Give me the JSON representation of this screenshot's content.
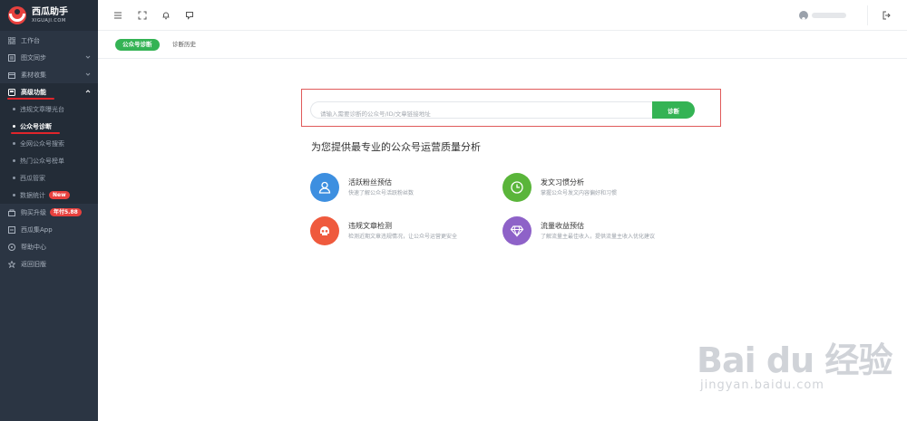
{
  "app": {
    "title": "西瓜助手",
    "subtitle": "XIGUAJI.COM"
  },
  "sidebar": {
    "items": [
      {
        "label": "工作台",
        "icon": "grid-icon"
      },
      {
        "label": "图文同步",
        "icon": "sync-icon",
        "has_arrow": true
      },
      {
        "label": "素材收集",
        "icon": "collection-icon",
        "has_arrow": true
      },
      {
        "label": "高级功能",
        "icon": "advanced-icon",
        "has_arrow": true,
        "expanded": true
      }
    ],
    "subitems": [
      {
        "label": "违规文章曝光台"
      },
      {
        "label": "公众号诊断",
        "active": true
      },
      {
        "label": "全网公众号搜索"
      },
      {
        "label": "热门公众号榜单"
      },
      {
        "label": "西瓜管家"
      },
      {
        "label": "数据统计",
        "badge": "New"
      }
    ],
    "bottom_items": [
      {
        "label": "购买升级",
        "icon": "upgrade-icon",
        "badge": "年付5.88"
      },
      {
        "label": "西瓜集App",
        "icon": "app-icon"
      },
      {
        "label": "帮助中心",
        "icon": "help-icon"
      },
      {
        "label": "返回旧版",
        "icon": "star-icon"
      }
    ]
  },
  "tabs": {
    "active": "公众号诊断",
    "other": "诊断历史"
  },
  "search": {
    "placeholder": "请输入需要诊断的公众号/ID/文章链接地址",
    "button": "诊断"
  },
  "headline": "为您提供最专业的公众号运营质量分析",
  "features": [
    {
      "title": "活跃粉丝预估",
      "desc": "快速了解公众号活跃粉丝数",
      "color": "#3d8fe0",
      "icon": "user-icon"
    },
    {
      "title": "发文习惯分析",
      "desc": "掌握公众号发文内容偏好和习惯",
      "color": "#5ab53a",
      "icon": "clock-icon"
    },
    {
      "title": "违规文章检测",
      "desc": "检测近期文章违规情况，让公众号运营更安全",
      "color": "#ef5a3d",
      "icon": "skull-icon"
    },
    {
      "title": "流量收益预估",
      "desc": "了解流量主最佳收入，提供流量主收入优化建议",
      "color": "#8e62c8",
      "icon": "diamond-icon"
    }
  ],
  "watermark": {
    "main": "Bai du 经验",
    "sub": "jingyan.baidu.com"
  },
  "colors": {
    "accent": "#34b354",
    "sidebar_bg": "#2b3543",
    "highlight": "#e0252b"
  }
}
